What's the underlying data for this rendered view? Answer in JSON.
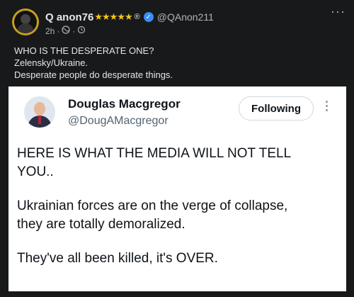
{
  "post": {
    "author": "Q anon76",
    "stars": "★★★★★",
    "registered_mark": "®",
    "verified_symbol": "✓",
    "handle": "@QAnon211",
    "time": "2h",
    "separator": "·",
    "audience_icon": "globe-icon",
    "more_label": "···",
    "caption": [
      "WHO IS THE DESPERATE ONE?",
      "Zelensky/Ukraine.",
      "Desperate people do desperate things."
    ]
  },
  "tweet_card": {
    "author_name": "Douglas Macgregor",
    "author_handle": "@DougAMacgregor",
    "follow_button": "Following",
    "paragraphs": [
      [
        "HERE IS WHAT THE MEDIA WILL NOT TELL",
        "YOU.."
      ],
      [
        "Ukrainian forces are on the verge of collapse,",
        "they are totally demoralized."
      ],
      [
        "They've all been killed, it's OVER."
      ]
    ]
  },
  "colors": {
    "page_background": "#18191a",
    "stars": "#f5c518",
    "verified_badge": "#3a8cf0",
    "card_background": "#ffffff"
  }
}
